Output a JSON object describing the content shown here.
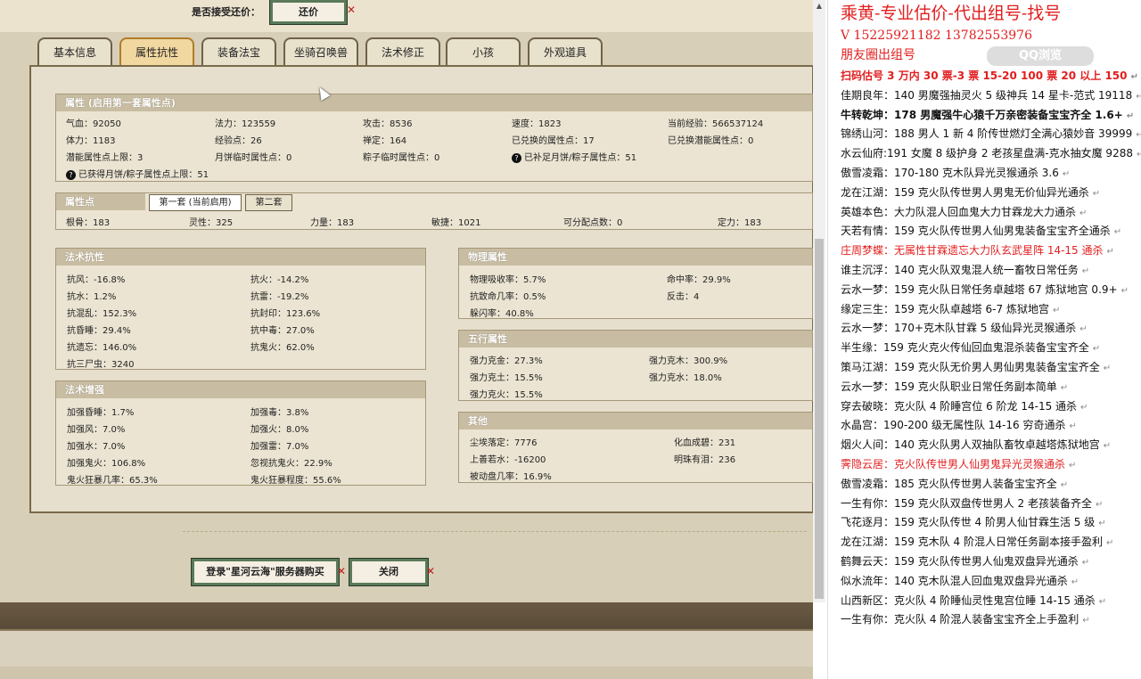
{
  "game": {
    "accept_label": "是否接受还价：",
    "haggle_button": "还价",
    "tabs": [
      "基本信息",
      "属性抗性",
      "装备法宝",
      "坐骑召唤兽",
      "法术修正",
      "小孩",
      "外观道具"
    ],
    "active_tab": "属性抗性",
    "attr_header": "属性 (启用第一套属性点)",
    "attr": {
      "qixue": "气血：92050",
      "fali": "法力：123559",
      "gongji": "攻击：8536",
      "sudu": "速度：1823",
      "jingyan": "当前经验：566537124",
      "tili": "体力：1183",
      "jingyandian": "经验点：26",
      "chanding": "禅定：164",
      "duihuan": "已兑换的属性点：17",
      "qianneng_dh": "已兑换潜能属性点：0",
      "qianneng_max": "潜能属性点上限：3",
      "yuebing": "月饼临时属性点：0",
      "zongzi": "粽子临时属性点：0",
      "buzu": "已补足月饼/粽子属性点：51",
      "huode": "已获得月饼/粽子属性点上限：51"
    },
    "points_header": "属性点",
    "subtabs": [
      "第一套 (当前启用)",
      "第二套"
    ],
    "points": {
      "gengu": "根骨：183",
      "lingxing": "灵性：325",
      "liliang": "力量：183",
      "minjie": "敏捷：1021",
      "kefenpei": "可分配点数：0",
      "dingli": "定力：183"
    },
    "resist_header": "法术抗性",
    "resist": [
      "抗风：-16.8%",
      "抗火：-14.2%",
      "抗水：1.2%",
      "抗雷：-19.2%",
      "抗混乱：152.3%",
      "抗封印：123.6%",
      "抗昏睡：29.4%",
      "抗中毒：27.0%",
      "抗遗忘：146.0%",
      "抗鬼火：62.0%",
      "抗三尸虫：3240"
    ],
    "enhance_header": "法术增强",
    "enhance": [
      "加强昏睡：1.7%",
      "加强毒：3.8%",
      "加强风：7.0%",
      "加强火：8.0%",
      "加强水：7.0%",
      "加强雷：7.0%",
      "加强鬼火：106.8%",
      "忽视抗鬼火：22.9%",
      "鬼火狂暴几率：65.3%",
      "鬼火狂暴程度：55.6%"
    ],
    "physical_header": "物理属性",
    "physical": [
      "物理吸收率：5.7%",
      "命中率：29.9%",
      "抗致命几率：0.5%",
      "反击：4",
      "躲闪率：40.8%"
    ],
    "wuxing_header": "五行属性",
    "wuxing": [
      "强力克金：27.3%",
      "强力克木：300.9%",
      "强力克土：15.5%",
      "强力克水：18.0%",
      "强力克火：15.5%"
    ],
    "other_header": "其他",
    "other": [
      "尘埃落定：7776",
      "化血成碧：231",
      "上善若水：-16200",
      "明珠有泪：236",
      "被动盘几率：16.9%"
    ],
    "login_button": "登录\"星河云海\"服务器购买",
    "close_button": "关闭"
  },
  "right": {
    "title": "乘黄-专业估价-代出组号-找号",
    "phone": "V   15225921182   13782553976",
    "friends": "朋友圈出组号",
    "watermark": "QQ浏览",
    "lines": [
      {
        "text": "扫码估号 3 万内 30 票-3       票   15-20 100 票 20 以上 150",
        "color": "red",
        "bold": true
      },
      {
        "text": "佳期良年：140 男魔强抽灵火 5 级神兵 14 星卡-范式 19118",
        "color": "black",
        "bold": false
      },
      {
        "text": "牛转乾坤：178 男魔强牛心猿千万亲密装备宝宝齐全 1.6+",
        "color": "black",
        "bold": true
      },
      {
        "text": "锦绣山河：188 男人 1 新 4 阶传世燃灯全满心猿妙音 39999",
        "color": "black",
        "bold": false
      },
      {
        "text": "水云仙府:191 女魔 8 级护身 2 老孩星盘满-克水抽女魔 9288",
        "color": "black",
        "bold": false
      },
      {
        "text": "傲雪凌霜：170-180 克木队异光灵猴通杀 3.6",
        "color": "black",
        "bold": false
      },
      {
        "text": "龙在江湖：159 克火队传世男人男鬼无价仙异光通杀",
        "color": "black",
        "bold": false
      },
      {
        "text": "英雄本色：大力队混人回血鬼大力甘霖龙大力通杀",
        "color": "black",
        "bold": false
      },
      {
        "text": "天若有情：159 克火队传世男人仙男鬼装备宝宝齐全通杀",
        "color": "black",
        "bold": false
      },
      {
        "text": "庄周梦蝶：无属性甘霖遗忘大力队玄武星阵 14-15 通杀",
        "color": "red",
        "bold": false
      },
      {
        "text": "谁主沉浮：140 克火队双鬼混人统一畜牧日常任务",
        "color": "black",
        "bold": false
      },
      {
        "text": "云水一梦：159 克火队日常任务卓越塔 67 炼狱地宫 0.9+",
        "color": "black",
        "bold": false
      },
      {
        "text": "缘定三生：159 克火队卓越塔 6-7 炼狱地宫",
        "color": "black",
        "bold": false
      },
      {
        "text": "云水一梦：170+克木队甘霖 5 级仙异光灵猴通杀",
        "color": "black",
        "bold": false
      },
      {
        "text": "半生缘：159 克火克火传仙回血鬼混杀装备宝宝齐全",
        "color": "black",
        "bold": false
      },
      {
        "text": "策马江湖：159 克火队无价男人男仙男鬼装备宝宝齐全",
        "color": "black",
        "bold": false
      },
      {
        "text": "云水一梦：159 克火队职业日常任务副本简单",
        "color": "black",
        "bold": false
      },
      {
        "text": "穿去破晓：克火队 4 阶睡宫位 6 阶龙 14-15 通杀",
        "color": "black",
        "bold": false
      },
      {
        "text": "水晶宫：190-200 级无属性队 14-16 穷奇通杀",
        "color": "black",
        "bold": false
      },
      {
        "text": "烟火人间：140 克火队男人双抽队畜牧卓越塔炼狱地宫",
        "color": "black",
        "bold": false
      },
      {
        "text": "霁隐云居：克火队传世男人仙男鬼异光灵猴通杀",
        "color": "red",
        "bold": false
      },
      {
        "text": "傲雪凌霜：185 克火队传世男人装备宝宝齐全",
        "color": "black",
        "bold": false
      },
      {
        "text": "一生有你：159 克火队双盘传世男人 2 老孩装备齐全",
        "color": "black",
        "bold": false
      },
      {
        "text": "飞花逐月：159 克火队传世 4 阶男人仙甘霖生活 5 级",
        "color": "black",
        "bold": false
      },
      {
        "text": "龙在江湖：159 克木队 4 阶混人日常任务副本接手盈利",
        "color": "black",
        "bold": false
      },
      {
        "text": "鹤舞云天：159 克火队传世男人仙鬼双盘异光通杀",
        "color": "black",
        "bold": false
      },
      {
        "text": "似水流年：140 克木队混人回血鬼双盘异光通杀",
        "color": "black",
        "bold": false
      },
      {
        "text": "山西新区：克火队 4 阶睡仙灵性鬼宫位睡 14-15 通杀",
        "color": "black",
        "bold": false
      },
      {
        "text": "一生有你：克火队 4 阶混人装备宝宝齐全上手盈利",
        "color": "black",
        "bold": false
      }
    ]
  }
}
